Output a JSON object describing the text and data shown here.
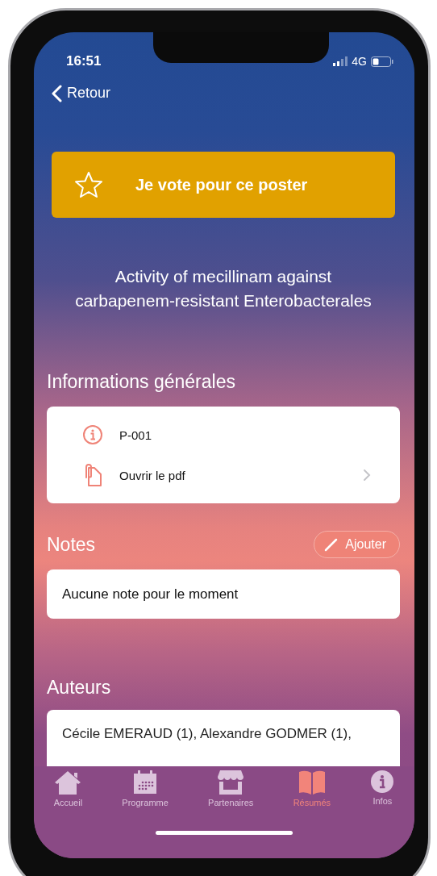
{
  "status_bar": {
    "time": "16:51",
    "network": "4G"
  },
  "nav": {
    "back_label": "Retour"
  },
  "vote_button": {
    "label": "Je vote pour ce poster",
    "voted": false
  },
  "poster_title": "Activity of mecillinam against carbapenem-resistant Enterobacterales",
  "general_info": {
    "heading": "Informations générales",
    "items": [
      {
        "kind": "info",
        "label": "P-001"
      },
      {
        "kind": "pdf",
        "label": "Ouvrir le pdf"
      }
    ]
  },
  "notes": {
    "heading": "Notes",
    "add_button": "Ajouter",
    "empty_text": "Aucune note pour le moment"
  },
  "authors": {
    "heading": "Auteurs",
    "text": "Cécile EMERAUD (1), Alexandre GODMER (1),"
  },
  "tab_bar": [
    {
      "kind": "home",
      "label": "Accueil",
      "selected": false
    },
    {
      "kind": "calendar",
      "label": "Programme",
      "selected": false
    },
    {
      "kind": "store",
      "label": "Partenaires",
      "selected": false
    },
    {
      "kind": "book",
      "label": "Résumés",
      "selected": true
    },
    {
      "kind": "info",
      "label": "Infos",
      "selected": false
    }
  ]
}
